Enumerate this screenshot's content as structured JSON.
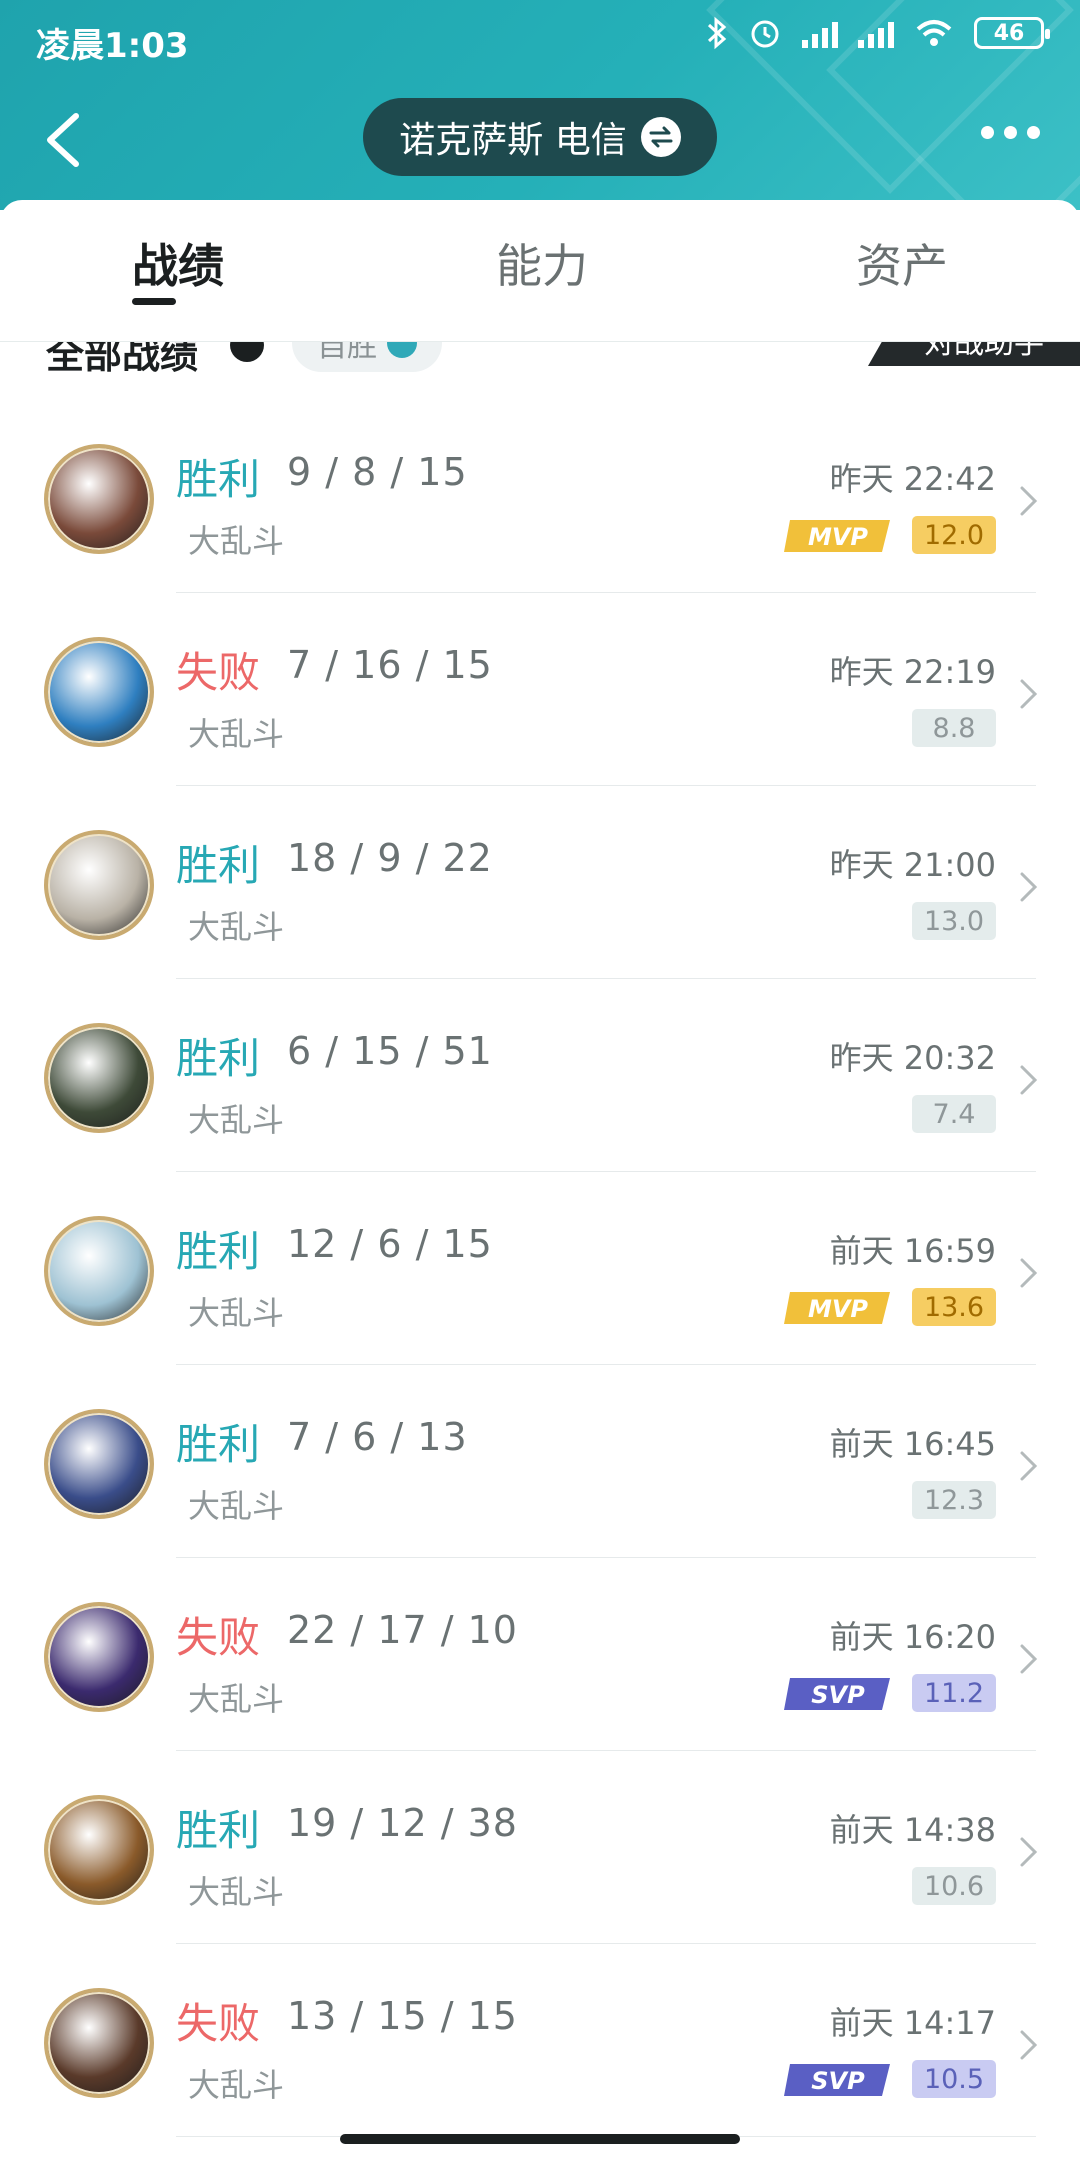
{
  "status_bar": {
    "time": "凌晨1:03",
    "battery": "46"
  },
  "header": {
    "server_label": "诺克萨斯 电信"
  },
  "tabs": [
    {
      "label": "战绩"
    },
    {
      "label": "能力"
    },
    {
      "label": "资产"
    }
  ],
  "filter": {
    "title": "全部战绩",
    "chip_label": "自胜",
    "helper_label": "对战助手"
  },
  "matches": [
    {
      "result": "胜利",
      "kda": "9 / 8 / 15",
      "mode": "大乱斗",
      "time": "昨天 22:42",
      "score": "12.0",
      "badge": "MVP",
      "avatar_color": "#7a4a3a"
    },
    {
      "result": "失败",
      "kda": "7 / 16 / 15",
      "mode": "大乱斗",
      "time": "昨天 22:19",
      "score": "8.8",
      "badge": "",
      "avatar_color": "#2f7fc0"
    },
    {
      "result": "胜利",
      "kda": "18 / 9 / 22",
      "mode": "大乱斗",
      "time": "昨天 21:00",
      "score": "13.0",
      "badge": "",
      "avatar_color": "#b9b2a6"
    },
    {
      "result": "胜利",
      "kda": "6 / 15 / 51",
      "mode": "大乱斗",
      "time": "昨天 20:32",
      "score": "7.4",
      "badge": "",
      "avatar_color": "#3e4a38"
    },
    {
      "result": "胜利",
      "kda": "12 / 6 / 15",
      "mode": "大乱斗",
      "time": "前天 16:59",
      "score": "13.6",
      "badge": "MVP",
      "avatar_color": "#9ec2d3"
    },
    {
      "result": "胜利",
      "kda": "7 / 6 / 13",
      "mode": "大乱斗",
      "time": "前天 16:45",
      "score": "12.3",
      "badge": "",
      "avatar_color": "#3a4d8a"
    },
    {
      "result": "失败",
      "kda": "22 / 17 / 10",
      "mode": "大乱斗",
      "time": "前天 16:20",
      "score": "11.2",
      "badge": "SVP",
      "avatar_color": "#3b2a6e"
    },
    {
      "result": "胜利",
      "kda": "19 / 12 / 38",
      "mode": "大乱斗",
      "time": "前天 14:38",
      "score": "10.6",
      "badge": "",
      "avatar_color": "#8a5a2a"
    },
    {
      "result": "失败",
      "kda": "13 / 15 / 15",
      "mode": "大乱斗",
      "time": "前天 14:17",
      "score": "10.5",
      "badge": "SVP",
      "avatar_color": "#5a3a2a"
    }
  ],
  "colors": {
    "header": "#25b0b8",
    "win": "#27a8b4",
    "loss": "#ec6868",
    "mvp": "#f6cd62",
    "svp": "#c9cbf2"
  }
}
